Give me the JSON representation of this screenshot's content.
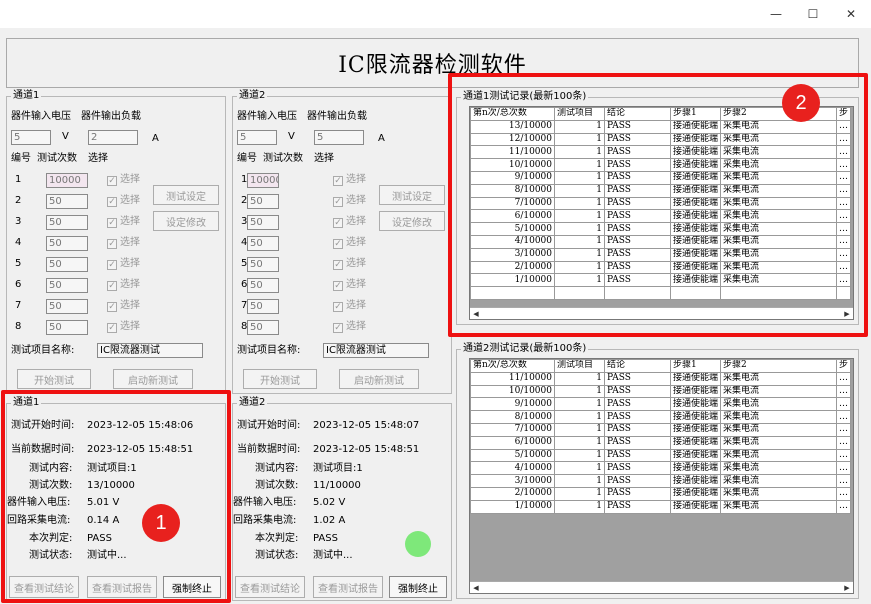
{
  "window": {
    "minimize": "—",
    "maximize": "☐",
    "close": "✕"
  },
  "app_title": "IC限流器检测软件",
  "channels": [
    {
      "group_title": "通道1",
      "voltage_label": "器件输入电压",
      "load_label": "器件输出负载",
      "voltage_value": "5",
      "voltage_unit": "V",
      "load_value": "2",
      "load_unit": "A",
      "col_no": "编号",
      "col_count": "测试次数",
      "col_select": "选择",
      "rows": [
        {
          "no": "1",
          "count": "10000",
          "select": "选择"
        },
        {
          "no": "2",
          "count": "50",
          "select": "选择"
        },
        {
          "no": "3",
          "count": "50",
          "select": "选择"
        },
        {
          "no": "4",
          "count": "50",
          "select": "选择"
        },
        {
          "no": "5",
          "count": "50",
          "select": "选择"
        },
        {
          "no": "6",
          "count": "50",
          "select": "选择"
        },
        {
          "no": "7",
          "count": "50",
          "select": "选择"
        },
        {
          "no": "8",
          "count": "50",
          "select": "选择"
        }
      ],
      "btn_test_setting": "测试设定",
      "btn_setting_modify": "设定修改",
      "project_name_label": "测试项目名称:",
      "project_name_value": "IC限流器测试",
      "btn_start": "开始测试",
      "btn_new_test": "启动新测试",
      "status": {
        "group_title": "通道1",
        "start_time_label": "测试开始时间:",
        "start_time": "2023-12-05 15:48:06",
        "data_time_label": "当前数据时间:",
        "data_time": "2023-12-05 15:48:51",
        "content_label": "测试内容:",
        "content": "测试项目:1",
        "count_label": "测试次数:",
        "count": "13/10000",
        "voltage_label": "器件输入电压:",
        "voltage": "5.01 V",
        "current_label": "回路采集电流:",
        "current": "0.14 A",
        "verdict_label": "本次判定:",
        "verdict": "PASS",
        "state_label": "测试状态:",
        "state": "测试中..."
      },
      "btn_view_result": "查看测试结论",
      "btn_view_report": "查看测试报告",
      "btn_force_stop": "强制终止"
    },
    {
      "group_title": "通道2",
      "voltage_label": "器件输入电压",
      "load_label": "器件输出负载",
      "voltage_value": "5",
      "voltage_unit": "V",
      "load_value": "5",
      "load_unit": "A",
      "col_no": "编号",
      "col_count": "测试次数",
      "col_select": "选择",
      "rows": [
        {
          "no": "1",
          "count": "10000",
          "select": "选择"
        },
        {
          "no": "2",
          "count": "50",
          "select": "选择"
        },
        {
          "no": "3",
          "count": "50",
          "select": "选择"
        },
        {
          "no": "4",
          "count": "50",
          "select": "选择"
        },
        {
          "no": "5",
          "count": "50",
          "select": "选择"
        },
        {
          "no": "6",
          "count": "50",
          "select": "选择"
        },
        {
          "no": "7",
          "count": "50",
          "select": "选择"
        },
        {
          "no": "8",
          "count": "50",
          "select": "选择"
        }
      ],
      "btn_test_setting": "测试设定",
      "btn_setting_modify": "设定修改",
      "project_name_label": "测试项目名称:",
      "project_name_value": "IC限流器测试",
      "btn_start": "开始测试",
      "btn_new_test": "启动新测试",
      "status": {
        "group_title": "通道2",
        "start_time_label": "测试开始时间:",
        "start_time": "2023-12-05 15:48:07",
        "data_time_label": "当前数据时间:",
        "data_time": "2023-12-05 15:48:51",
        "content_label": "测试内容:",
        "content": "测试项目:1",
        "count_label": "测试次数:",
        "count": "11/10000",
        "voltage_label": "器件输入电压:",
        "voltage": "5.02 V",
        "current_label": "回路采集电流:",
        "current": "1.02 A",
        "verdict_label": "本次判定:",
        "verdict": "PASS",
        "state_label": "测试状态:",
        "state": "测试中..."
      },
      "btn_view_result": "查看测试结论",
      "btn_view_report": "查看测试报告",
      "btn_force_stop": "强制终止",
      "indicator_color": "#7ee87a"
    }
  ],
  "records": [
    {
      "title": "通道1测试记录(最新100条)",
      "headers": [
        "第n次/总次数",
        "测试项目",
        "结论",
        "步骤1",
        "步骤2",
        "步"
      ],
      "rows": [
        [
          "13/10000",
          "1",
          "PASS",
          "接通使能端",
          "采集电流",
          "…"
        ],
        [
          "12/10000",
          "1",
          "PASS",
          "接通使能端",
          "采集电流",
          "…"
        ],
        [
          "11/10000",
          "1",
          "PASS",
          "接通使能端",
          "采集电流",
          "…"
        ],
        [
          "10/10000",
          "1",
          "PASS",
          "接通使能端",
          "采集电流",
          "…"
        ],
        [
          "9/10000",
          "1",
          "PASS",
          "接通使能端",
          "采集电流",
          "…"
        ],
        [
          "8/10000",
          "1",
          "PASS",
          "接通使能端",
          "采集电流",
          "…"
        ],
        [
          "7/10000",
          "1",
          "PASS",
          "接通使能端",
          "采集电流",
          "…"
        ],
        [
          "6/10000",
          "1",
          "PASS",
          "接通使能端",
          "采集电流",
          "…"
        ],
        [
          "5/10000",
          "1",
          "PASS",
          "接通使能端",
          "采集电流",
          "…"
        ],
        [
          "4/10000",
          "1",
          "PASS",
          "接通使能端",
          "采集电流",
          "…"
        ],
        [
          "3/10000",
          "1",
          "PASS",
          "接通使能端",
          "采集电流",
          "…"
        ],
        [
          "2/10000",
          "1",
          "PASS",
          "接通使能端",
          "采集电流",
          "…"
        ],
        [
          "1/10000",
          "1",
          "PASS",
          "接通使能端",
          "采集电流",
          "…"
        ],
        [
          "",
          "",
          "",
          "",
          "",
          ""
        ]
      ]
    },
    {
      "title": "通道2测试记录(最新100条)",
      "headers": [
        "第n次/总次数",
        "测试项目",
        "结论",
        "步骤1",
        "步骤2",
        "步"
      ],
      "rows": [
        [
          "11/10000",
          "1",
          "PASS",
          "接通使能端",
          "采集电流",
          "…"
        ],
        [
          "10/10000",
          "1",
          "PASS",
          "接通使能端",
          "采集电流",
          "…"
        ],
        [
          "9/10000",
          "1",
          "PASS",
          "接通使能端",
          "采集电流",
          "…"
        ],
        [
          "8/10000",
          "1",
          "PASS",
          "接通使能端",
          "采集电流",
          "…"
        ],
        [
          "7/10000",
          "1",
          "PASS",
          "接通使能端",
          "采集电流",
          "…"
        ],
        [
          "6/10000",
          "1",
          "PASS",
          "接通使能端",
          "采集电流",
          "…"
        ],
        [
          "5/10000",
          "1",
          "PASS",
          "接通使能端",
          "采集电流",
          "…"
        ],
        [
          "4/10000",
          "1",
          "PASS",
          "接通使能端",
          "采集电流",
          "…"
        ],
        [
          "3/10000",
          "1",
          "PASS",
          "接通使能端",
          "采集电流",
          "…"
        ],
        [
          "2/10000",
          "1",
          "PASS",
          "接通使能端",
          "采集电流",
          "…"
        ],
        [
          "1/10000",
          "1",
          "PASS",
          "接通使能端",
          "采集电流",
          "…"
        ]
      ]
    }
  ],
  "annotations": {
    "badge1": "1",
    "badge2": "2",
    "highlight_color": "#e11111"
  },
  "icons": {
    "checkbox": "checkmark-icon",
    "scroll_left": "arrow-left-icon",
    "scroll_right": "arrow-right-icon"
  }
}
